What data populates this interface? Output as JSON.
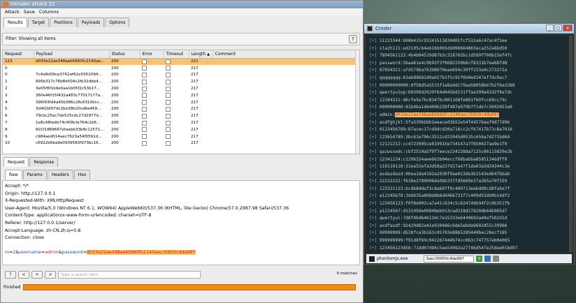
{
  "burp": {
    "title": "Intruder attack 22",
    "menu": [
      "Attack",
      "Save",
      "Columns"
    ],
    "tabs": [
      "Results",
      "Target",
      "Positions",
      "Payloads",
      "Options"
    ],
    "filter": "Filter: Showing all items",
    "help": "?",
    "columns": [
      "Request",
      "Payload",
      "Status",
      "Error",
      "Timeout",
      "Length",
      "▲",
      "Comment"
    ],
    "rows": [
      {
        "req": "123",
        "payload": "d033e22ae348aeb5660fc2140ae...",
        "status": "200",
        "length": "221",
        "selected": true
      },
      {
        "req": "0",
        "payload": "",
        "status": "200",
        "length": "217"
      },
      {
        "req": "0",
        "payload": "7c4a8d09ca3762af61e5952094...",
        "status": "200",
        "length": "217"
      },
      {
        "req": "1",
        "payload": "895b317c76b8e504c2fb32dbb4...",
        "status": "200",
        "length": "217"
      },
      {
        "req": "2",
        "payload": "3e05f6f1b9e0aa1b05f2c53b17...",
        "status": "200",
        "length": "217"
      },
      {
        "req": "3",
        "payload": "360e46f15f432a483c77017177a...",
        "status": "200",
        "length": "217"
      },
      {
        "req": "4",
        "payload": "396f93fd4a45b386c28c63100cc...",
        "status": "200",
        "length": "217"
      },
      {
        "req": "5",
        "payload": "3d4f2bf07dc1be38b20cd6e469...",
        "status": "200",
        "length": "217"
      },
      {
        "req": "6",
        "payload": "79cbc25ac7de525cdc27d2977d...",
        "status": "200",
        "length": "217"
      },
      {
        "req": "7",
        "payload": "1e8c48fedb74c408cfa764c2e6...",
        "status": "200",
        "length": "217"
      },
      {
        "req": "8",
        "payload": "601f1889667efaebb33b8c12572...",
        "status": "200",
        "length": "217"
      },
      {
        "req": "9",
        "payload": "c984aed014aec7623a54f0591d...",
        "status": "200",
        "length": "217"
      },
      {
        "req": "10",
        "payload": "c6922b6ba9e0939583f973bc16...",
        "status": "200",
        "length": "217"
      }
    ],
    "reqtabs": [
      "Request",
      "Response"
    ],
    "viewtabs": [
      "Raw",
      "Params",
      "Headers",
      "Hex"
    ],
    "request_lines": [
      "Accept: */*",
      "Origin: http://127.0.0.1",
      "X-Requested-With: XMLHttpRequest",
      "User-Agent: Mozilla/5.0 (Windows NT 6.1; WOW64) AppleWebKit/537.36 (KHTML, like Gecko) Chrome/57.0.2987.98 Safari/537.36",
      "Content-Type: application/x-www-form-urlencoded; charset=UTF-8",
      "Referer: http://127.0.0.1/server/",
      "Accept-Language: zh-CN,zh;q=0.8",
      "Connection: close"
    ],
    "body": {
      "m_key": "m",
      "m_val": "2",
      "u_key": "username",
      "u_val": "admin",
      "p_key": "password",
      "p_val": "d033e22ae348aeb5660fc2140aec35850c4da997"
    },
    "nav": [
      "?",
      "<",
      "+",
      ">"
    ],
    "search_placeholder": "Type a search term",
    "matches": "0 matches",
    "status": "Finished",
    "progress": 1.0
  },
  "cmder": {
    "title": "Cmder",
    "lines": [
      "11223344:b986415c93241513d30d01fcf532a6c47ac4f3ee",
      "xlazh111:ed2105cb4e616b065ddd96664863aca252a6bd50",
      "7894561123:4b4b04529d87b5c318702bc1d589f700b15ef4fc",
      "password:5baa61e4c9b93f3f0682250b6cf8331b7ee68fd8",
      "87654321:a7d579ba76398070eae654c30ff153a4c273272a",
      "qqqqqqqq:63ab89682d9a027b1f5c91f6b0ed347ef7dc9ac7",
      "00000000000:0f58d5a5515f1a8a9d179aa58058b67b2f8a3388",
      "qwertyu1op:b0399d2029f64d445bd131ffaa399a42d2f8e7dc",
      "12344321:d6cfe5e76c8347bc801168fe861f69fcc69cc79c",
      "000000000:81b4ba1d6409b259f487e079b7f1de7c3042053a0",
      "admin:d033e22ae348aeb5660fc2140aec35850c4da997",
      "asdfghjkl:5fa339bbbb1eeaced3b52e54f44576aaf0d77d96",
      "0123456789:87acec17cd9dcd20a716cc2cf67417b71c8a7016",
      "123654789:3bc61e796c3512cd22045d0535c656a7d271bd64",
      "12121212:cc4723995ce819915e734147a7f850427ae9e1f9",
      "qazwsxedc:cbf2510a5f9f7eece234228da7125c06115839e2b",
      "12341234:c129b324aee662b04eccf68babba85851346dff9",
      "110110110:31ea52efa3d58a237d17a47f1da63a3d24244c3e",
      "asdasdasd:00ea1da4192a2030f9ae023de3b3143ed647bbab",
      "22222222:f638e2789006da9bb337fd5689e37a265a70f359",
      "123321123:bcdb84daf3c8a607f9c490713eebdd9cd8fa5e7f",
      "a12345678:3dd635a808ddb6dd4b6731f7c409d53dd4b14df2",
      "123456123:f0f8e902ca7a41c634c5c8247d4b94f2c9b351fb",
      "a1234567:d13149de00848eb013cad318d27829db64b965d7",
      "qwertyui:7d8f4b4b4613dc7e15333e6449692ad4af502d1d",
      "asdfasdf:92429d82a41e930486c6de5ebda9602d55c39986",
      "99999999:d528fca3b163c05703e88b5285440bec28ecf185",
      "999999999:f91d8f69c042267444b74cc0b3c747757eb0e065",
      "123456123456:71dd07494c5ee54992a27746d547e25dee01bd97"
    ],
    "highlight_index": 10,
    "highlight_prefix": "admin:",
    "highlight_hash": "d033e22ae348aeb5660fc2140aec35850c4da997",
    "prompt_marker": "[+]",
    "task": "phantomjs.exe",
    "search_value": "3aec35850c4da997"
  }
}
